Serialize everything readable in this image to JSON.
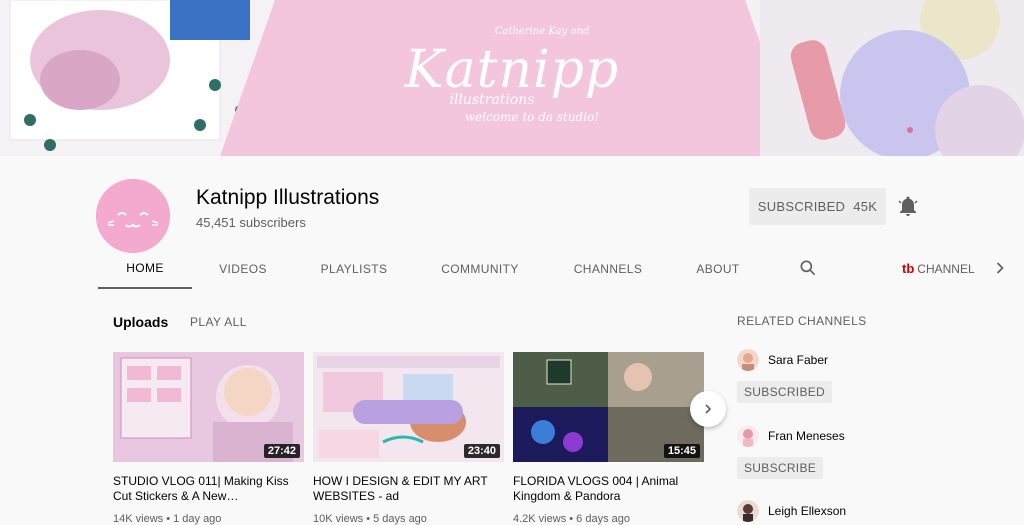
{
  "banner": {
    "subtitle": "Catherine Kay and",
    "title": "Katnipp",
    "line1": "illustrations",
    "line2": "welcome to da studio!"
  },
  "channel": {
    "name": "Katnipp Illustrations",
    "subscribers": "45,451 subscribers",
    "subscribe_label": "SUBSCRIBED",
    "subscribe_count": "45K"
  },
  "tabs": [
    "HOME",
    "VIDEOS",
    "PLAYLISTS",
    "COMMUNITY",
    "CHANNELS",
    "ABOUT"
  ],
  "promo_tab": {
    "icon": "tb",
    "label": "CHANNEL"
  },
  "uploads": {
    "title": "Uploads",
    "play_all": "PLAY ALL",
    "videos": [
      {
        "title": "STUDIO VLOG 011| Making Kiss Cut Stickers & A New…",
        "duration": "27:42",
        "meta": "14K views • 1 day ago"
      },
      {
        "title": "HOW I DESIGN & EDIT MY ART WEBSITES - ad",
        "duration": "23:40",
        "meta": "10K views • 5 days ago"
      },
      {
        "title": "FLORIDA VLOGS 004 | Animal Kingdom & Pandora",
        "duration": "15:45",
        "meta": "4.2K views • 6 days ago"
      }
    ]
  },
  "related": {
    "title": "RELATED CHANNELS",
    "channels": [
      {
        "name": "Sara Faber",
        "button": "SUBSCRIBED"
      },
      {
        "name": "Fran Meneses",
        "button": "SUBSCRIBE"
      },
      {
        "name": "Leigh Ellexson"
      }
    ]
  },
  "colors": {
    "brand_pink": "#f4a9cf",
    "background": "#f9f9f9",
    "button_gray": "#ececec"
  }
}
